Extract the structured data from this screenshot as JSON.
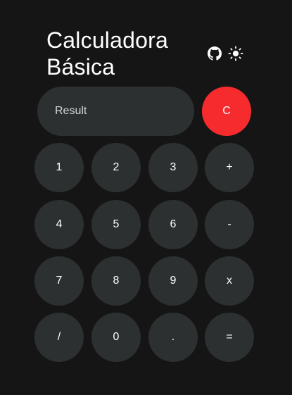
{
  "header": {
    "title_line1": "Calculadora",
    "title_line2": "Básica"
  },
  "icons": {
    "github": "github-icon",
    "theme": "sun-icon"
  },
  "display": {
    "result_placeholder": "Result"
  },
  "clear_label": "C",
  "keys": {
    "k1": "1",
    "k2": "2",
    "k3": "3",
    "plus": "+",
    "k4": "4",
    "k5": "5",
    "k6": "6",
    "minus": "-",
    "k7": "7",
    "k8": "8",
    "k9": "9",
    "multiply": "x",
    "divide": "/",
    "k0": "0",
    "dot": ".",
    "equals": "="
  },
  "colors": {
    "background": "#151515",
    "button": "#2d3030",
    "clear": "#f52b2e",
    "text": "#ffffff"
  }
}
